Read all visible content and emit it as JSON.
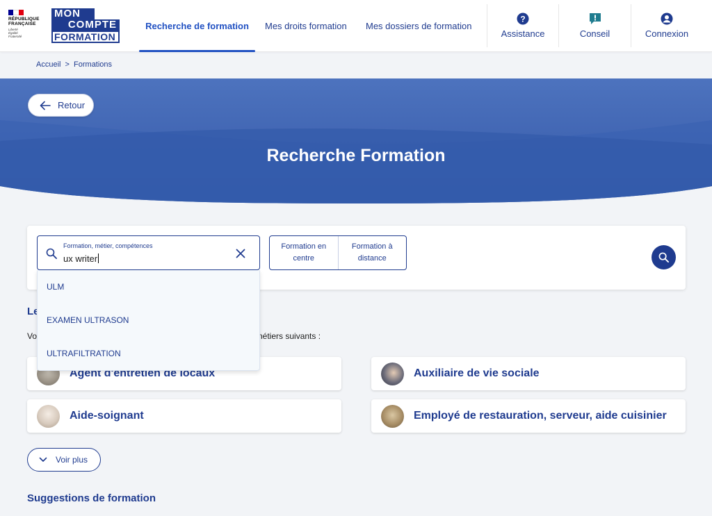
{
  "header": {
    "gov_logo": {
      "line1": "RÉPUBLIQUE",
      "line2": "FRANÇAISE",
      "motto1": "Liberté",
      "motto2": "Égalité",
      "motto3": "Fraternité"
    },
    "brand_logo": {
      "line1": "MON",
      "line2": "COMPTE",
      "line3": "FORMATION"
    },
    "nav": [
      {
        "label": "Recherche de formation",
        "active": true
      },
      {
        "label": "Mes droits formation",
        "active": false
      },
      {
        "label": "Mes dossiers de formation",
        "active": false
      }
    ],
    "utilities": [
      {
        "label": "Assistance",
        "icon": "question-circle-icon"
      },
      {
        "label": "Conseil",
        "icon": "chat-alert-icon"
      },
      {
        "label": "Connexion",
        "icon": "user-circle-icon"
      }
    ]
  },
  "breadcrumb": {
    "home": "Accueil",
    "separator": ">",
    "current": "Formations"
  },
  "hero": {
    "back_label": "Retour",
    "title": "Recherche Formation"
  },
  "search": {
    "label": "Formation, métier, compétences",
    "value": "ux writer",
    "mode_options": [
      "Formation en centre",
      "Formation à distance"
    ]
  },
  "autocomplete": [
    "ULM",
    "EXAMEN ULTRASON",
    "ULTRAFILTRATION"
  ],
  "section": {
    "heading_visible": "Le",
    "text_start": "Vo",
    "text_end": "nétiers suivants :"
  },
  "jobs": [
    {
      "title": "Agent d'entretien de locaux"
    },
    {
      "title": "Auxiliaire de vie sociale"
    },
    {
      "title": "Aide-soignant"
    },
    {
      "title": "Employé de restauration, serveur, aide cuisinier"
    }
  ],
  "more_label": "Voir plus",
  "suggestions_heading": "Suggestions de formation",
  "colors": {
    "primary": "#1f3b8f",
    "active_nav": "#2050c2",
    "hero_blue": "#3a63b3",
    "flag_blue": "#000091",
    "flag_red": "#e1000f"
  }
}
